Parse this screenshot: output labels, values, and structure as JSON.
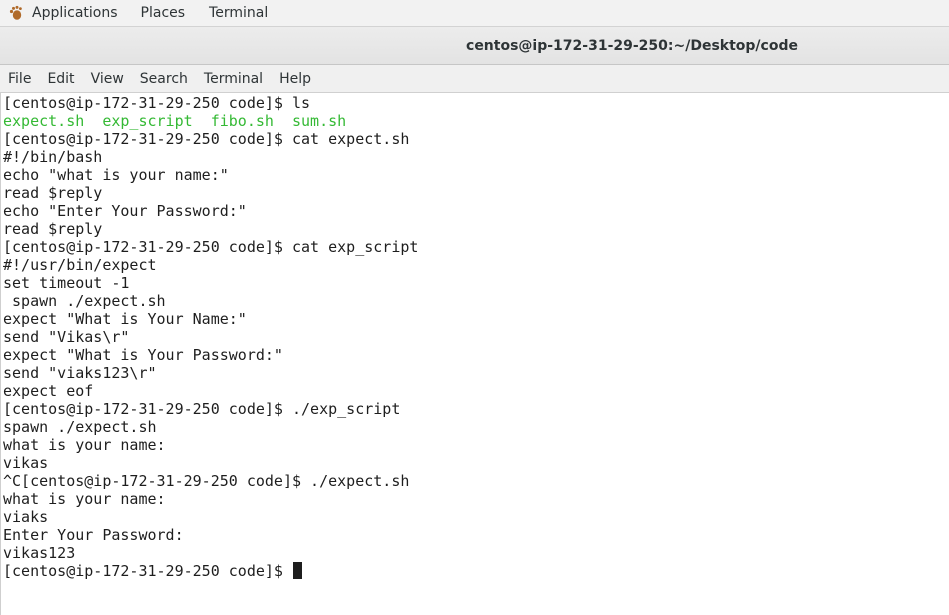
{
  "top_panel": {
    "applications": "Applications",
    "places": "Places",
    "terminal": "Terminal",
    "apps_icon": "gnome-foot-icon"
  },
  "window": {
    "title": "centos@ip-172-31-29-250:~/Desktop/code"
  },
  "menu": {
    "file": "File",
    "edit": "Edit",
    "view": "View",
    "search": "Search",
    "terminal": "Terminal",
    "help": "Help"
  },
  "terminal": {
    "lines": [
      "[centos@ip-172-31-29-250 code]$ ls",
      "",
      "[centos@ip-172-31-29-250 code]$ cat expect.sh",
      "#!/bin/bash",
      "echo \"what is your name:\"",
      "read $reply",
      "echo \"Enter Your Password:\"",
      "read $reply",
      "[centos@ip-172-31-29-250 code]$ cat exp_script",
      "#!/usr/bin/expect",
      "set timeout -1",
      " spawn ./expect.sh",
      "expect \"What is Your Name:\"",
      "send \"Vikas\\r\"",
      "expect \"What is Your Password:\"",
      "send \"viaks123\\r\"",
      "expect eof",
      "[centos@ip-172-31-29-250 code]$ ./exp_script",
      "spawn ./expect.sh",
      "what is your name:",
      "vikas",
      "^C[centos@ip-172-31-29-250 code]$ ./expect.sh",
      "what is your name:",
      "viaks",
      "Enter Your Password:",
      "vikas123"
    ],
    "ls_files": [
      "expect.sh",
      "exp_script",
      "fibo.sh",
      "sum.sh"
    ],
    "final_prompt": "[centos@ip-172-31-29-250 code]$ ",
    "ls_color": "#34b934"
  }
}
